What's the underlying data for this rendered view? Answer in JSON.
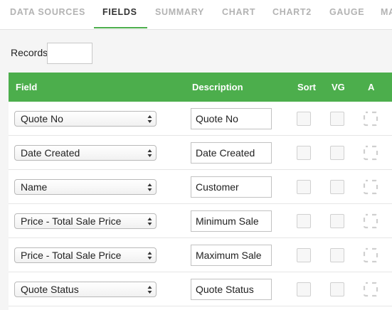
{
  "tabs": [
    {
      "label": "DATA SOURCES",
      "active": false
    },
    {
      "label": "FIELDS",
      "active": true
    },
    {
      "label": "SUMMARY",
      "active": false
    },
    {
      "label": "CHART",
      "active": false
    },
    {
      "label": "CHART2",
      "active": false
    },
    {
      "label": "GAUGE",
      "active": false
    },
    {
      "label": "MA",
      "active": false
    }
  ],
  "records": {
    "label": "Records",
    "value": ""
  },
  "table": {
    "headers": {
      "field": "Field",
      "description": "Description",
      "sort": "Sort",
      "vg": "VG",
      "a": "A"
    },
    "rows": [
      {
        "field": "Quote No",
        "description": "Quote No",
        "sort": false,
        "vg": false
      },
      {
        "field": "Date Created",
        "description": "Date Created",
        "sort": false,
        "vg": false
      },
      {
        "field": "Name",
        "description": "Customer",
        "sort": false,
        "vg": false
      },
      {
        "field": "Price - Total Sale Price",
        "description": "Minimum Sale",
        "sort": false,
        "vg": false
      },
      {
        "field": "Price - Total Sale Price",
        "description": "Maximum Sale",
        "sort": false,
        "vg": false
      },
      {
        "field": "Quote Status",
        "description": "Quote Status",
        "sort": false,
        "vg": false
      }
    ]
  },
  "colors": {
    "accent": "#4cae4c",
    "tab_inactive": "#b3b3b3",
    "tab_active": "#333333"
  },
  "icons": {
    "select_arrows": "up-down-arrows-icon",
    "aggregate": "dashed-square-icon"
  }
}
